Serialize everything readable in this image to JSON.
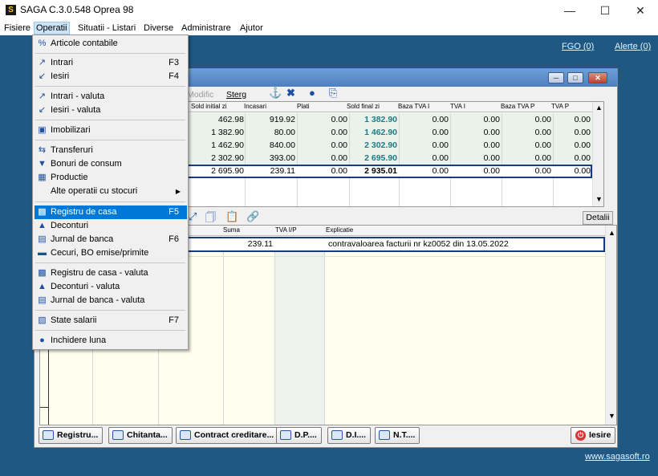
{
  "window": {
    "title": "SAGA C.3.0.548  Oprea 98"
  },
  "menubar": [
    "Fisiere",
    "Operatii",
    "Situatii - Listari",
    "Diverse",
    "Administrare",
    "Ajutor"
  ],
  "top_links": {
    "fgo": "FGO (0)",
    "alerte": "Alerte (0)"
  },
  "toolbar": {
    "modify": "Modific",
    "delete": "Sterg"
  },
  "upper_grid": {
    "headers": [
      "Sold initial zi",
      "Incasari",
      "Plati",
      "Sold final zi",
      "Baza TVA I",
      "TVA I",
      "Baza TVA P",
      "TVA P"
    ],
    "rows": [
      [
        "462.98",
        "919.92",
        "0.00",
        "1 382.90",
        "0.00",
        "0.00",
        "0.00",
        "0.00"
      ],
      [
        "1 382.90",
        "80.00",
        "0.00",
        "1 462.90",
        "0.00",
        "0.00",
        "0.00",
        "0.00"
      ],
      [
        "1 462.90",
        "840.00",
        "0.00",
        "2 302.90",
        "0.00",
        "0.00",
        "0.00",
        "0.00"
      ],
      [
        "2 302.90",
        "393.00",
        "0.00",
        "2 695.90",
        "0.00",
        "0.00",
        "0.00",
        "0.00"
      ],
      [
        "2 695.90",
        "239.11",
        "0.00",
        "2 935.01",
        "0.00",
        "0.00",
        "0.00",
        "0.00"
      ]
    ]
  },
  "detalii_button": "Detalii",
  "lower_grid": {
    "headers": [
      "Suma",
      "TVA I/P",
      "Explicatie"
    ],
    "row": {
      "suma": "239.11",
      "tva": "",
      "explicatie": "contravaloarea facturii nr kz0052 din 13.05.2022"
    }
  },
  "bottom_buttons": [
    "Registru...",
    "Chitanta...",
    "Contract creditare...",
    "D.P....",
    "D.I....",
    "N.T....",
    "Iesire"
  ],
  "footer_link": "www.sagasoft.ro",
  "dropdown": [
    {
      "label": "Articole contabile",
      "shortcut": "",
      "icon": "percent-icon"
    },
    {
      "label": "Intrari",
      "shortcut": "F3",
      "icon": "in-arrow-icon"
    },
    {
      "label": "Iesiri",
      "shortcut": "F4",
      "icon": "out-arrow-icon"
    },
    {
      "label": "Intrari - valuta",
      "shortcut": "",
      "icon": "in-currency-icon"
    },
    {
      "label": "Iesiri - valuta",
      "shortcut": "",
      "icon": "out-currency-icon"
    },
    {
      "label": "Imobilizari",
      "shortcut": "",
      "icon": "assets-icon"
    },
    {
      "label": "Transferuri",
      "shortcut": "",
      "icon": "transfer-icon"
    },
    {
      "label": "Bonuri de consum",
      "shortcut": "",
      "icon": "consumption-icon"
    },
    {
      "label": "Productie",
      "shortcut": "",
      "icon": "production-icon"
    },
    {
      "label": "Alte operatii cu stocuri",
      "shortcut": "",
      "icon": "submenu-arrow-icon"
    },
    {
      "label": "Registru de casa",
      "shortcut": "F5",
      "icon": "cash-register-icon"
    },
    {
      "label": "Deconturi",
      "shortcut": "",
      "icon": "settlement-icon"
    },
    {
      "label": "Jurnal de banca",
      "shortcut": "F6",
      "icon": "bank-icon"
    },
    {
      "label": "Cecuri, BO emise/primite",
      "shortcut": "",
      "icon": "cheque-icon"
    },
    {
      "label": "Registru de casa - valuta",
      "shortcut": "",
      "icon": "cash-register-currency-icon"
    },
    {
      "label": "Deconturi - valuta",
      "shortcut": "",
      "icon": "settlement-currency-icon"
    },
    {
      "label": "Jurnal de banca - valuta",
      "shortcut": "",
      "icon": "bank-currency-icon"
    },
    {
      "label": "State salarii",
      "shortcut": "F7",
      "icon": "payroll-icon"
    },
    {
      "label": "Inchidere luna",
      "shortcut": "",
      "icon": "lock-icon"
    }
  ]
}
